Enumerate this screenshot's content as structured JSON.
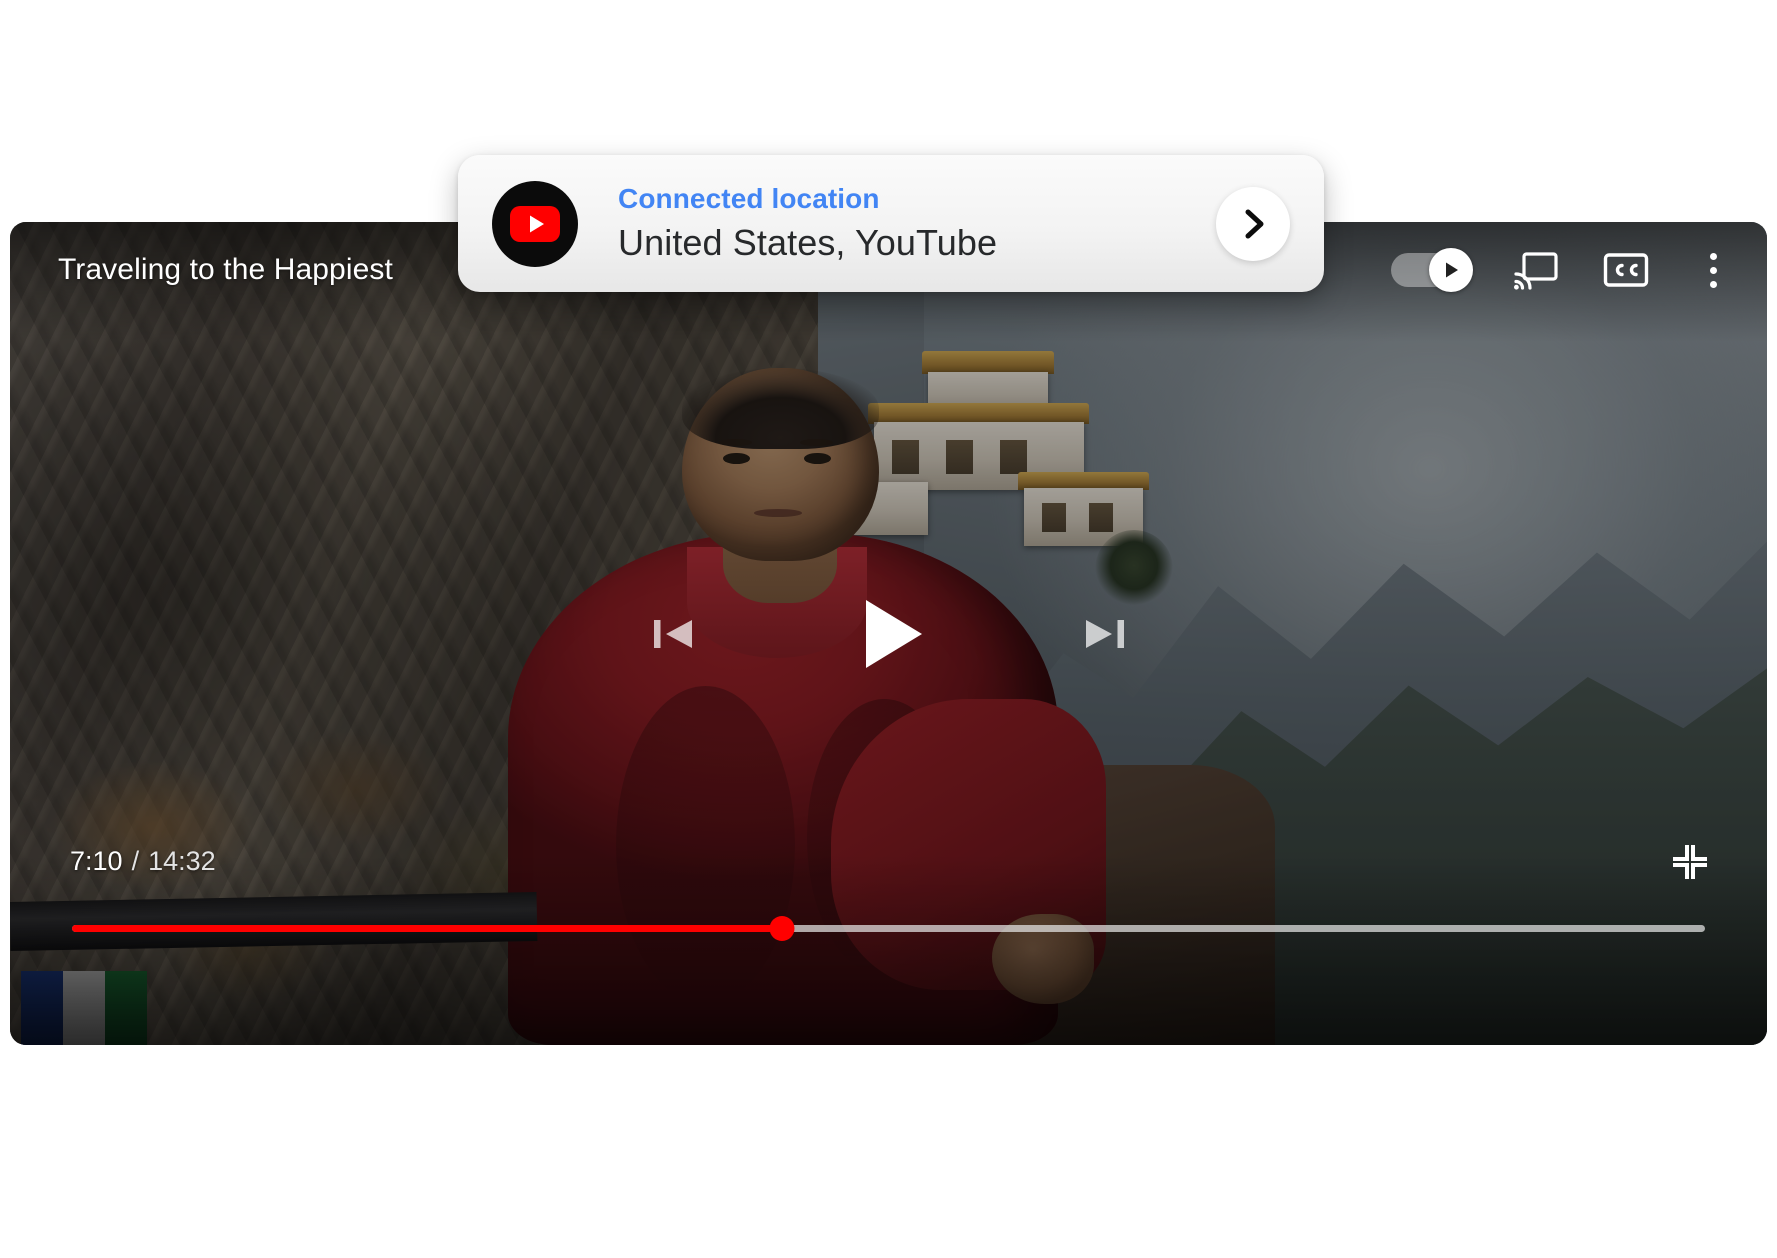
{
  "player": {
    "video_title": "Traveling to the Happiest",
    "current_time": "7:10",
    "time_separator": "/",
    "total_time": "14:32",
    "progress_percent": 43.5,
    "controls": {
      "previous_label": "previous-track",
      "play_label": "play",
      "next_label": "next-track",
      "autoplay_label": "autoplay",
      "autoplay_state": "on",
      "cast_label": "cast",
      "captions_label": "CC",
      "more_label": "more-options",
      "collapse_label": "exit-fullscreen"
    }
  },
  "connected_card": {
    "label": "Connected location",
    "value": "United States, YouTube",
    "service_icon": "youtube-logo",
    "chevron_icon": "chevron-right-icon"
  },
  "colors": {
    "accent_blue": "#4285f4",
    "progress_red": "#ff0000",
    "youtube_red": "#ff0000",
    "card_background": "#f3f3f3",
    "page_background": "#ffffff"
  }
}
